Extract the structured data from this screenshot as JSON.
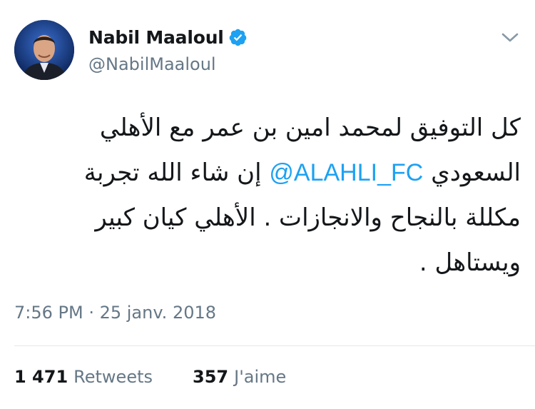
{
  "tweet": {
    "display_name": "Nabil Maaloul",
    "handle": "@NabilMaaloul",
    "verified": true,
    "text_lines": [
      "كل التوفيق لمحمد امين بن عمر مع الأهلي",
      "",
      "مكللة بالنجاح والانجازات . الأهلي كيان كبير",
      "ويستاهل ."
    ],
    "line2_before": "السعودي",
    "mention": "@ALAHLI_FC",
    "line2_after": "إن شاء الله تجربة",
    "timestamp": "7:56 PM · 25 janv. 2018",
    "retweets_count": "1 471",
    "retweets_label": "Retweets",
    "likes_count": "357",
    "likes_label": "J'aime"
  },
  "colors": {
    "link": "#1da1f2",
    "secondary_text": "#657786",
    "verified_badge": "#1da1f2"
  },
  "icons": [
    "verified-badge-icon",
    "chevron-down-icon"
  ]
}
